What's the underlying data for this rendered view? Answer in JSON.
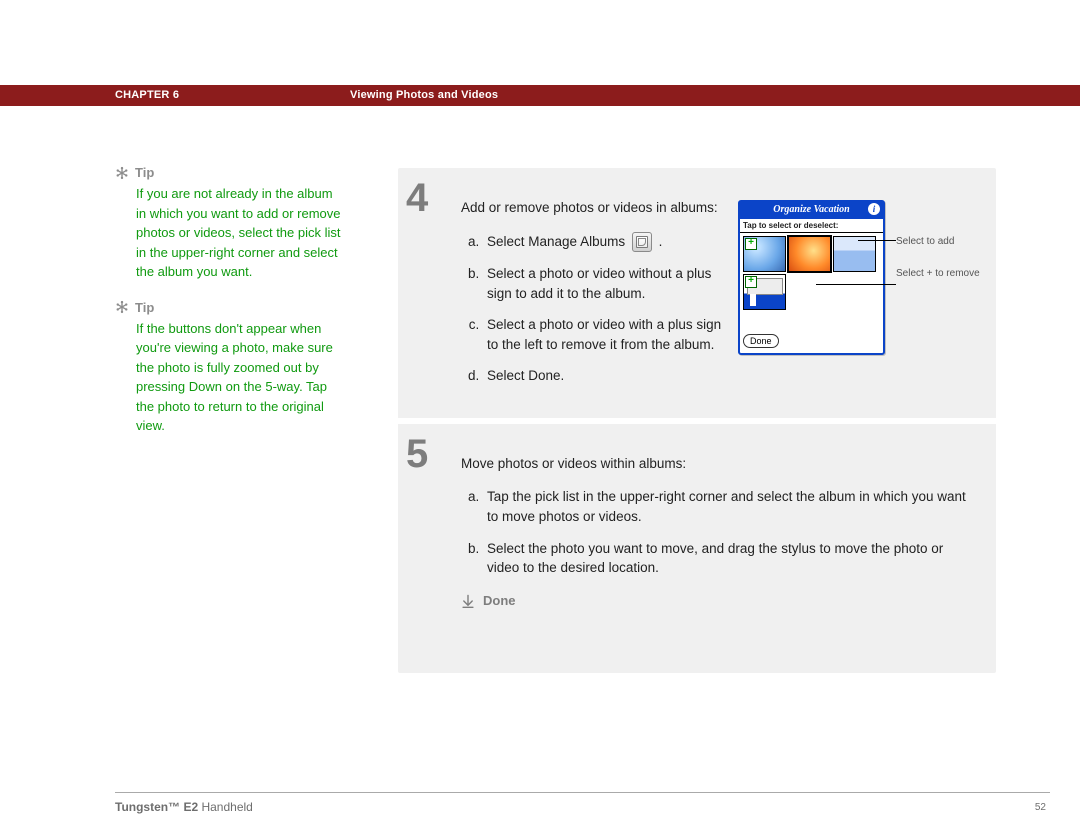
{
  "header": {
    "chapter": "CHAPTER 6",
    "title": "Viewing Photos and Videos"
  },
  "tips": [
    {
      "label": "Tip",
      "body": "If you are not already in the album in which you want to add or remove photos or videos, select the pick list in the upper-right corner and select the album you want."
    },
    {
      "label": "Tip",
      "body": "If the buttons don't appear when you're viewing a photo, make sure the photo is fully zoomed out by pressing Down on the 5-way. Tap the photo to return to the original view."
    }
  ],
  "steps": {
    "four": {
      "num": "4",
      "lead": "Add or remove photos or videos in albums:",
      "a_prefix": "Select Manage Albums",
      "a_suffix": ".",
      "b": "Select a photo or video without a plus sign to add it to the album.",
      "c": "Select a photo or video with a plus sign to the left to remove it from the album.",
      "d": "Select Done."
    },
    "five": {
      "num": "5",
      "lead": "Move photos or videos within albums:",
      "a": "Tap the pick list in the upper-right corner and select the album in which you want to move photos or videos.",
      "b": "Select the photo you want to move, and drag the stylus to move the photo or video to the desired location."
    }
  },
  "done_label": "Done",
  "palm": {
    "title": "Organize Vacation",
    "hint": "Tap to select or deselect:",
    "done_btn": "Done"
  },
  "callouts": {
    "add": "Select to add",
    "remove": "Select + to remove"
  },
  "footer": {
    "product_strong": "Tungsten™ E2",
    "product_rest": " Handheld",
    "page": "52"
  }
}
